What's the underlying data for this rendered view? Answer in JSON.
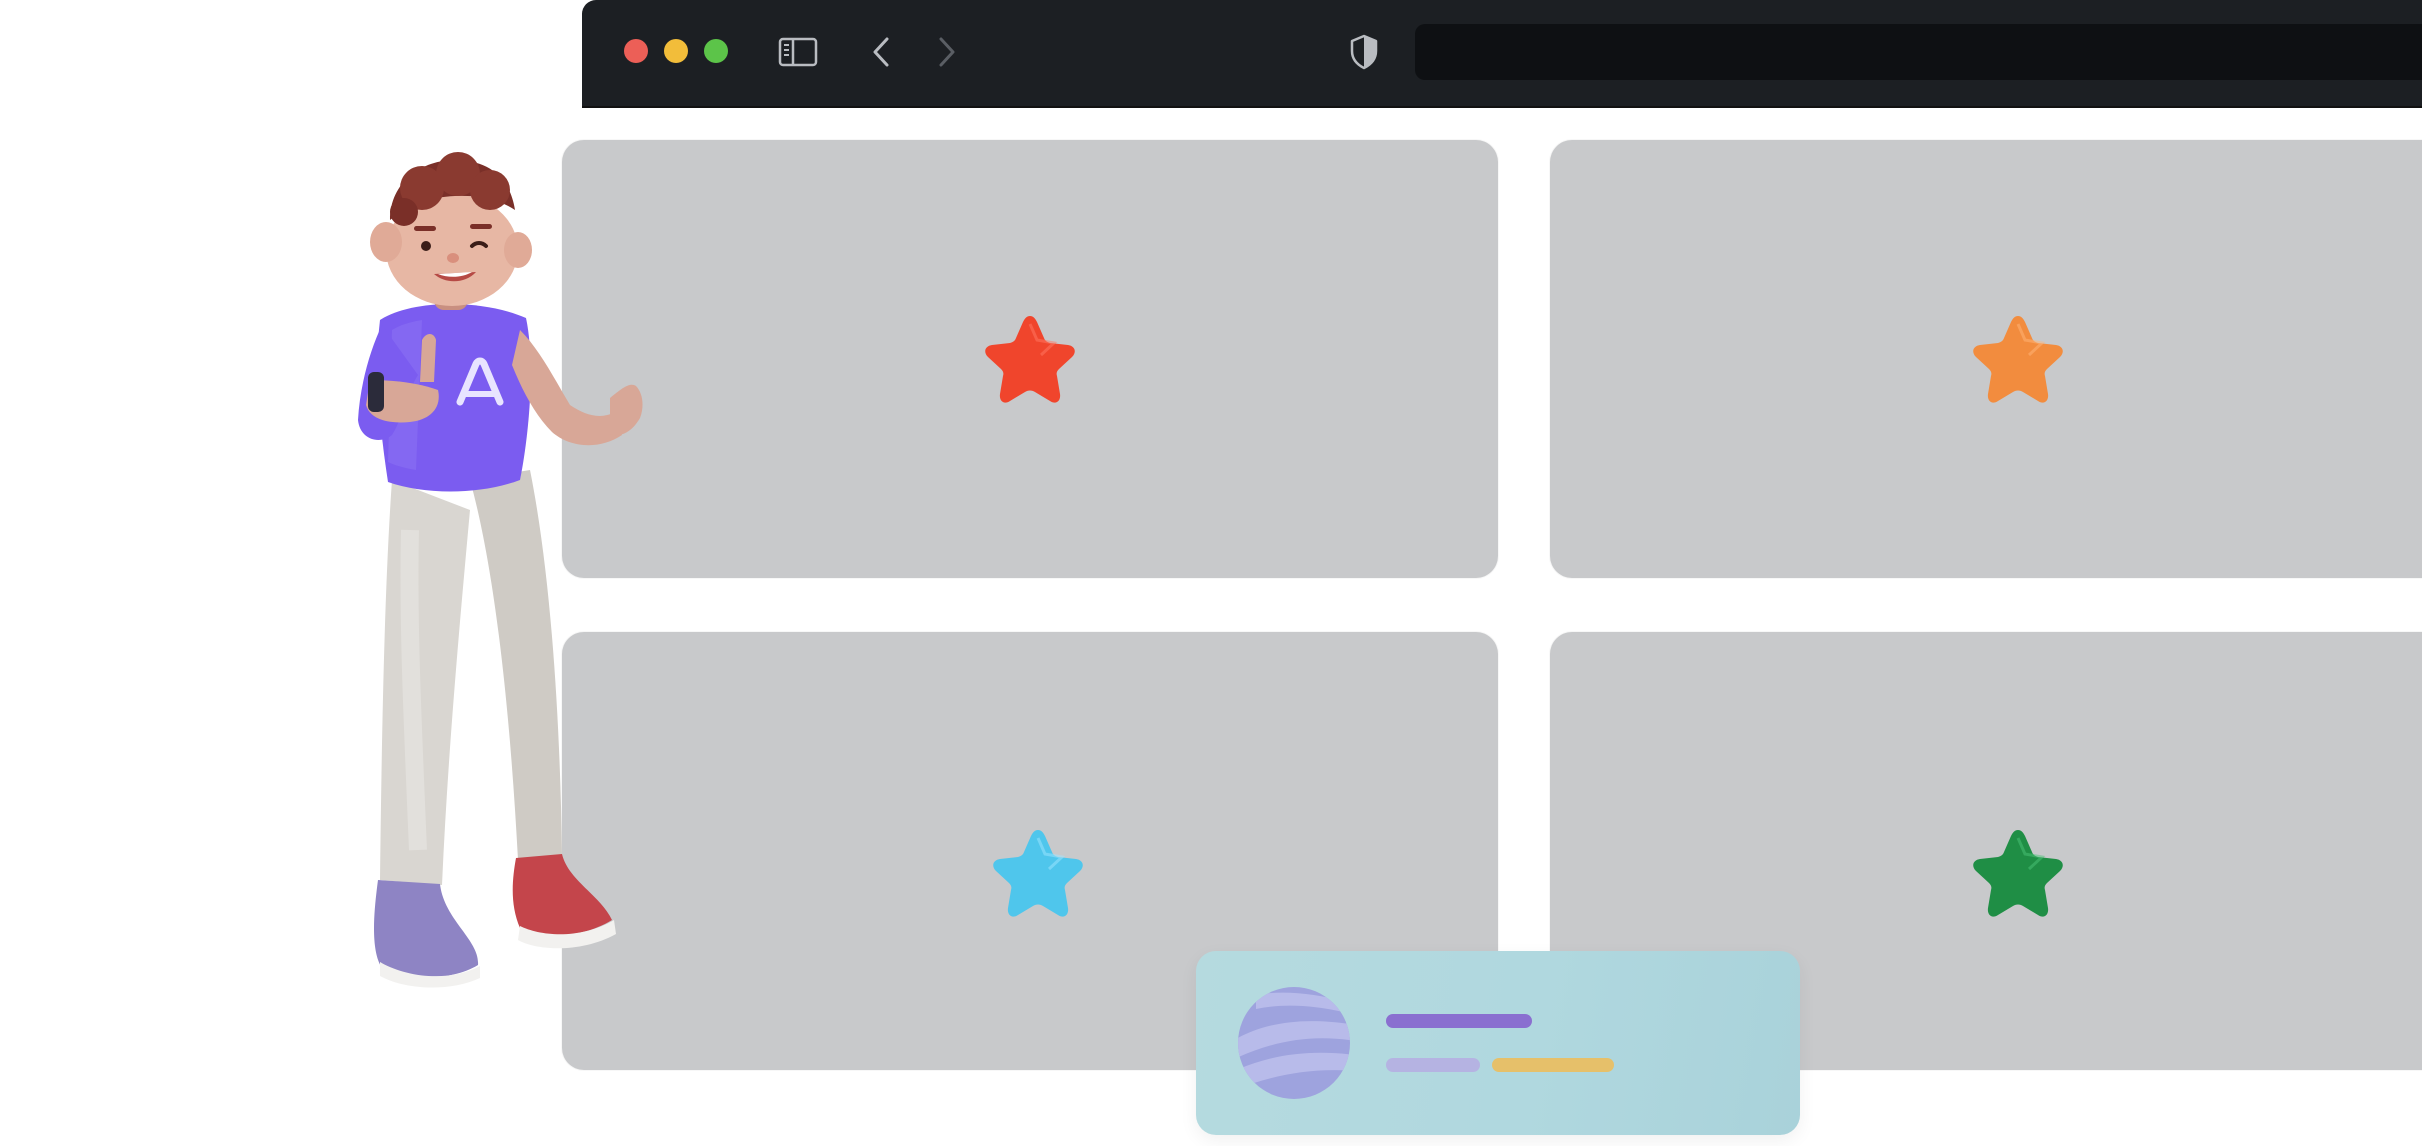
{
  "browser": {
    "address_bar": {
      "value": "",
      "placeholder": ""
    },
    "traffic_lights": [
      "close",
      "minimize",
      "zoom"
    ],
    "icons": [
      "sidebar-toggle-icon",
      "back-arrow-icon",
      "forward-arrow-icon",
      "shield-icon"
    ]
  },
  "cards": [
    {
      "id": "top-left",
      "star_color": "#f0452c"
    },
    {
      "id": "top-right",
      "star_color": "#f28c3e"
    },
    {
      "id": "bottom-left",
      "star_color": "#4fc6ec"
    },
    {
      "id": "bottom-right",
      "star_color": "#1f8e45"
    }
  ],
  "character": {
    "shirt_color": "#7b5cf0",
    "shirt_logo": "A"
  },
  "colors": {
    "chrome_bg": "#1c1f23",
    "card_bg": "#c8c9cb",
    "profile_bg": "#b0d8df"
  }
}
